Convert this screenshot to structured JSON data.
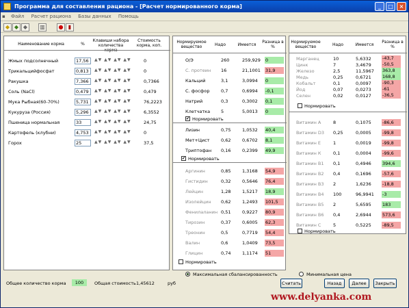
{
  "title": "Программа для составления рациона - [Расчет нормированного корма]",
  "menu": [
    "Файл",
    "Расчет рациона",
    "Базы данных",
    "Помощь"
  ],
  "left": {
    "headers": {
      "name": "Наименование корма",
      "pct": "%",
      "keys": "Клавиши набора количества корма",
      "cost": "Стоимость корма, коп."
    },
    "rows": [
      {
        "name": "Жмых подсолнечный",
        "pct": "17,56",
        "cost": "0"
      },
      {
        "name": "Трикальцийфосфат",
        "pct": "0,813",
        "cost": "0"
      },
      {
        "name": "Ракушка",
        "pct": "7,366",
        "cost": "0,7366"
      },
      {
        "name": "Соль (NaCl)",
        "pct": "0,479",
        "cost": "0,479"
      },
      {
        "name": "Мука Рыбная(60-70%)",
        "pct": "5,731",
        "cost": "76,2223"
      },
      {
        "name": "Кукуруза (Россия)",
        "pct": "5,296",
        "cost": "6,3552"
      },
      {
        "name": "Пшеница нормальная",
        "pct": "33",
        "cost": "24,75"
      },
      {
        "name": "Картофель (клубни)",
        "pct": "4,753",
        "cost": "0"
      },
      {
        "name": "Горох",
        "pct": "25",
        "cost": "37,5"
      }
    ],
    "total_label": "Общее количество корма",
    "total_value": "100",
    "cost_label": "Общая стоимость",
    "cost_value": "1,45612",
    "cost_unit": "руб"
  },
  "mid": {
    "headers": {
      "sub": "Нормируемое вещество",
      "norm": "Надо",
      "have": "Имеется",
      "diff": "Разница в %"
    },
    "group1": [
      {
        "name": "О/Э",
        "norm": "260",
        "have": "259,929",
        "diff": "0",
        "c": "green",
        "gray": false
      },
      {
        "name": "С. протеин",
        "norm": "16",
        "have": "21,1001",
        "diff": "31,9",
        "c": "red",
        "gray": true
      },
      {
        "name": "Кальций",
        "norm": "3,1",
        "have": "3,0994",
        "diff": "0",
        "c": "green",
        "gray": false
      },
      {
        "name": "С. фосфор",
        "norm": "0,7",
        "have": "0,6994",
        "diff": "-0,1",
        "c": "green",
        "gray": false
      },
      {
        "name": "Натрий",
        "norm": "0,3",
        "have": "0,3002",
        "diff": "0,1",
        "c": "green",
        "gray": false
      },
      {
        "name": "Клетчатка",
        "norm": "5",
        "have": "5,0013",
        "diff": "0",
        "c": "green",
        "gray": false
      }
    ],
    "group2": [
      {
        "name": "Лизин",
        "norm": "0,75",
        "have": "1,0532",
        "diff": "40,4",
        "c": "green"
      },
      {
        "name": "Мет+Цист",
        "norm": "0,62",
        "have": "0,6702",
        "diff": "8,1",
        "c": "green"
      },
      {
        "name": "Триптофан",
        "norm": "0,16",
        "have": "0,2399",
        "diff": "49,9",
        "c": "green"
      }
    ],
    "group3": [
      {
        "name": "Аргинин",
        "norm": "0,85",
        "have": "1,3168",
        "diff": "54,9",
        "c": "red"
      },
      {
        "name": "Гистидин",
        "norm": "0,32",
        "have": "0,5646",
        "diff": "76,4",
        "c": "red"
      },
      {
        "name": "Лейцин",
        "norm": "1,28",
        "have": "1,5217",
        "diff": "18,9",
        "c": "green"
      },
      {
        "name": "Изолейцин",
        "norm": "0,62",
        "have": "1,2493",
        "diff": "101,5",
        "c": "red"
      },
      {
        "name": "Фенилаланин",
        "norm": "0,51",
        "have": "0,9227",
        "diff": "80,9",
        "c": "red"
      },
      {
        "name": "Тирозин",
        "norm": "0,37",
        "have": "0,6005",
        "diff": "62,3",
        "c": "red"
      },
      {
        "name": "Треонин",
        "norm": "0,5",
        "have": "0,7719",
        "diff": "54,4",
        "c": "red"
      },
      {
        "name": "Валин",
        "norm": "0,6",
        "have": "1,0409",
        "diff": "73,5",
        "c": "red"
      },
      {
        "name": "Глицин",
        "norm": "0,74",
        "have": "1,1174",
        "diff": "51",
        "c": "red"
      }
    ],
    "normirovat": "Нормировать"
  },
  "right": {
    "headers": {
      "sub": "Нормируемое вещество",
      "norm": "Надо",
      "have": "Имеется",
      "diff": "Разница в %"
    },
    "group1": [
      {
        "name": "Марганец",
        "norm": "10",
        "have": "5,6332",
        "diff": "-43,7",
        "c": "red"
      },
      {
        "name": "Цинк",
        "norm": "7",
        "have": "3,4679",
        "diff": "-50,5",
        "c": "red"
      },
      {
        "name": "Железо",
        "norm": "2,5",
        "have": "11,5967",
        "diff": "363,8",
        "c": "green"
      },
      {
        "name": "Медь",
        "norm": "0,25",
        "have": "0,6721",
        "diff": "168,8",
        "c": "green"
      },
      {
        "name": "Кобальт",
        "norm": "0,1",
        "have": "0,0097",
        "diff": "-90,3",
        "c": "red"
      },
      {
        "name": "Йод",
        "norm": "0,07",
        "have": "0,0273",
        "diff": "-61",
        "c": "red"
      },
      {
        "name": "Селен",
        "norm": "0,02",
        "have": "0,0127",
        "diff": "-36,5",
        "c": "red"
      }
    ],
    "group2": [
      {
        "name": "Витамин А",
        "norm": "8",
        "have": "0,1075",
        "diff": "-86,6",
        "c": "red"
      },
      {
        "name": "Витамин D3",
        "norm": "0,25",
        "have": "0,0005",
        "diff": "-99,8",
        "c": "red"
      },
      {
        "name": "Витамин Е",
        "norm": "1",
        "have": "0,0019",
        "diff": "-99,8",
        "c": "red"
      },
      {
        "name": "Витамин К",
        "norm": "0,1",
        "have": "0,0004",
        "diff": "-99,6",
        "c": "red"
      },
      {
        "name": "Витамин В1",
        "norm": "0,1",
        "have": "0,4946",
        "diff": "394,6",
        "c": "green"
      },
      {
        "name": "Витамин В2",
        "norm": "0,4",
        "have": "0,1696",
        "diff": "-57,6",
        "c": "red"
      },
      {
        "name": "Витамин В3",
        "norm": "2",
        "have": "1,6236",
        "diff": "-18,8",
        "c": "red"
      },
      {
        "name": "Витамин В4",
        "norm": "100",
        "have": "96,9941",
        "diff": "-3",
        "c": "green"
      },
      {
        "name": "Витамин В5",
        "norm": "2",
        "have": "5,6595",
        "diff": "183",
        "c": "green"
      },
      {
        "name": "Витамин В6",
        "norm": "0,4",
        "have": "2,6944",
        "diff": "573,6",
        "c": "red"
      },
      {
        "name": "Витамин С",
        "norm": "5",
        "have": "0,5225",
        "diff": "-89,5",
        "c": "red"
      }
    ],
    "normirovat": "Нормировать"
  },
  "footer": {
    "radio1": "Максимальная сбалансированность",
    "radio2": "Минимальная цена",
    "calc": "Считать",
    "back": "Назад",
    "next": "Далее",
    "close": "Закрыть"
  },
  "watermark": "www.delyanka.com"
}
